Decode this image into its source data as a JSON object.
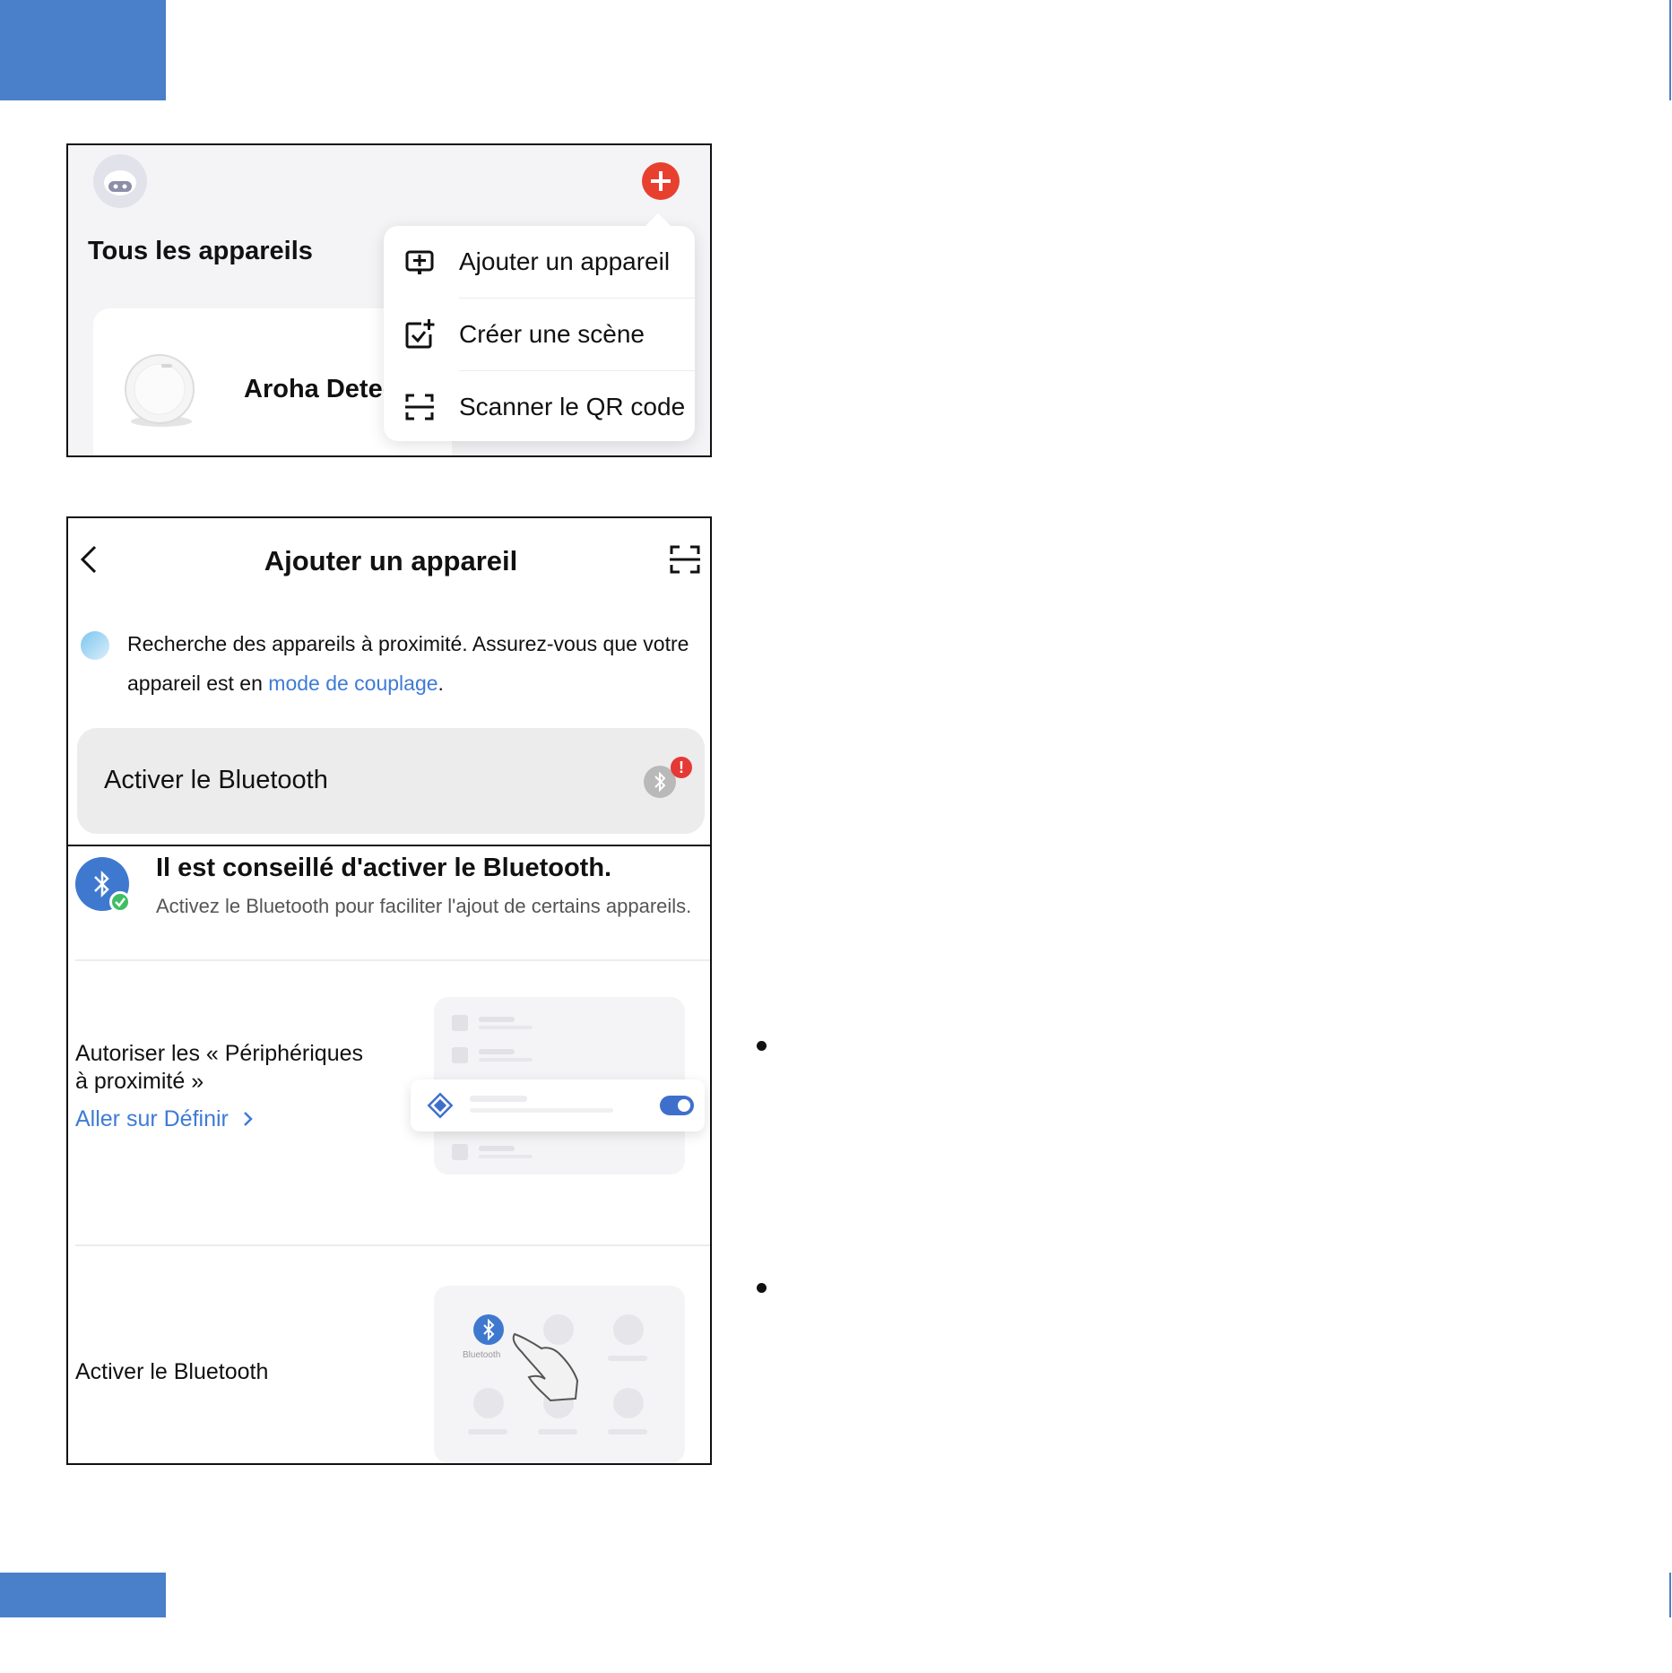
{
  "colors": {
    "accent": "#4a7fc9",
    "plus": "#e8402f",
    "link": "#3e7bd6",
    "alert": "#e53935",
    "success": "#3fbf62"
  },
  "home": {
    "avatar_icon": "robot-avatar-icon",
    "add_icon": "plus-icon",
    "title": "Tous les appareils",
    "device_name": "Aroha Detecte",
    "menu": {
      "items": [
        {
          "label": "Ajouter un appareil",
          "icon": "add-device-icon"
        },
        {
          "label": "Créer une scène",
          "icon": "create-scene-icon"
        },
        {
          "label": "Scanner le QR code",
          "icon": "scan-qr-icon"
        }
      ]
    }
  },
  "add_device": {
    "title": "Ajouter un appareil",
    "back_icon": "chevron-left-icon",
    "scan_icon": "scan-qr-icon",
    "search_text_prefix": "Recherche des appareils à proximité. Assurez-vous que votre appareil est en ",
    "search_link": "mode de couplage",
    "search_text_suffix": ".",
    "bluetooth_row_label": "Activer le Bluetooth",
    "bluetooth_alert": "!"
  },
  "bluetooth_prompt": {
    "title": "Il est conseillé d'activer le Bluetooth.",
    "subtitle": "Activez le Bluetooth pour faciliter l'ajout de certains appareils.",
    "permission_label": "Autoriser les « Périphériques à proximité »",
    "permission_link": "Aller sur Définir",
    "enable_label": "Activer le Bluetooth",
    "illus_bt_label": "Bluetooth"
  }
}
